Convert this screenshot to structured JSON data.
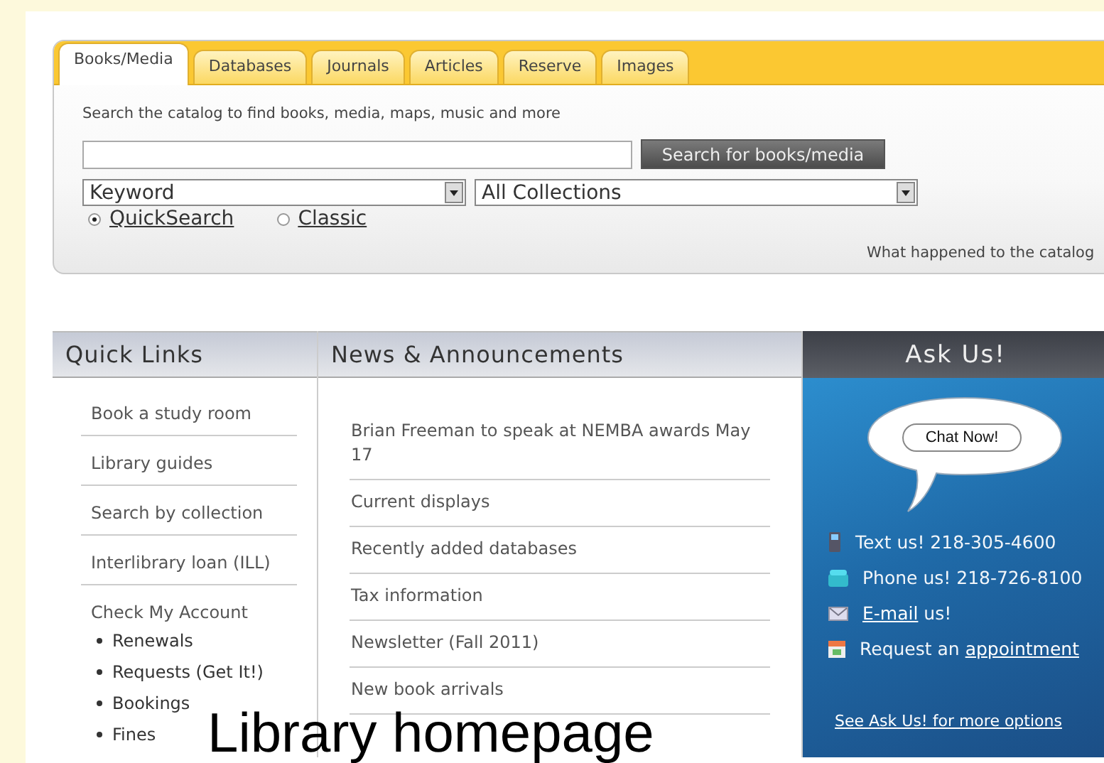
{
  "search_panel": {
    "tabs": [
      {
        "label": "Books/Media",
        "selected": true
      },
      {
        "label": "Databases",
        "selected": false
      },
      {
        "label": "Journals",
        "selected": false
      },
      {
        "label": "Articles",
        "selected": false
      },
      {
        "label": "Reserve",
        "selected": false
      },
      {
        "label": "Images",
        "selected": false
      }
    ],
    "description": "Search the catalog to find books, media, maps, music and more",
    "search_button": "Search for books/media",
    "search_type": "Keyword",
    "collection": "All Collections",
    "modes": [
      {
        "label": "QuickSearch",
        "selected": true
      },
      {
        "label": "Classic",
        "selected": false
      }
    ],
    "footer_link": "What happened to the catalog"
  },
  "quick_links": {
    "title": "Quick Links",
    "items": [
      {
        "label": "Book a study room"
      },
      {
        "label": "Library guides"
      },
      {
        "label": "Search by collection"
      },
      {
        "label": "Interlibrary loan (ILL)"
      },
      {
        "label": "Check My Account",
        "children": [
          {
            "label": "Renewals"
          },
          {
            "label": "Requests (Get It!)"
          },
          {
            "label": "Bookings"
          },
          {
            "label": "Fines"
          }
        ]
      }
    ]
  },
  "news": {
    "title": "News & Announcements",
    "items": [
      "Brian Freeman to speak at NEMBA awards May 17",
      "Current displays",
      "Recently added databases",
      "Tax information",
      "Newsletter (Fall 2011)",
      "New book arrivals"
    ]
  },
  "ask_us": {
    "title": "Ask Us!",
    "chat_button": "Chat Now!",
    "contacts": [
      {
        "kind": "mobile",
        "before": "Text us! 218-305-4600"
      },
      {
        "kind": "phone",
        "before": "Phone us! 218-726-8100"
      },
      {
        "kind": "email",
        "link": "E-mail",
        "after": " us!"
      },
      {
        "kind": "calendar",
        "before": "Request an ",
        "link": "appointment"
      }
    ],
    "more_link": "See Ask Us! for more options"
  },
  "caption": "Library homepage"
}
